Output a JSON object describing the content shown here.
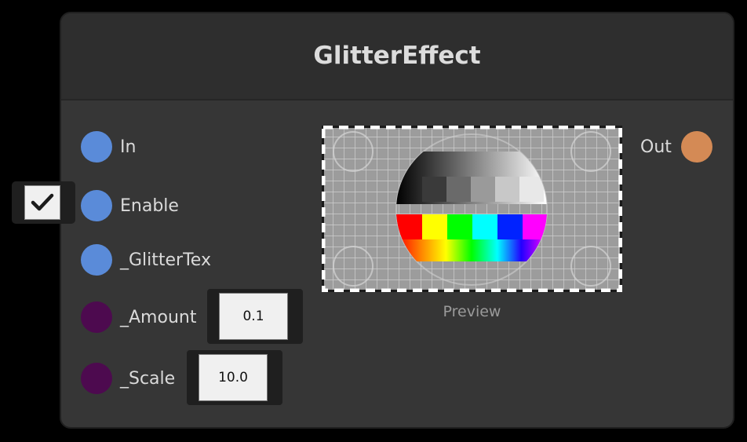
{
  "node": {
    "title": "GlitterEffect",
    "inputs": [
      {
        "label": "In",
        "color": "#5a8bd9"
      },
      {
        "label": "Enable",
        "color": "#5a8bd9"
      },
      {
        "label": "_GlitterTex",
        "color": "#5a8bd9"
      },
      {
        "label": "_Amount",
        "color": "#4d0a4f",
        "value": "0.1"
      },
      {
        "label": "_Scale",
        "color": "#4d0a4f",
        "value": "10.0"
      }
    ],
    "enable_checked": true,
    "outputs": [
      {
        "label": "Out",
        "color": "#d48a55"
      }
    ],
    "preview": {
      "label": "Preview"
    }
  },
  "colors": {
    "background": "#000000",
    "node_body": "#363636",
    "node_header": "#2e2e2e",
    "input_port": "#5a8bd9",
    "property_port": "#4d0a4f",
    "output_port": "#d48a55"
  },
  "icons": {
    "enable_toggle": "checkmark-icon",
    "preview_image": "test-pattern-preview"
  }
}
